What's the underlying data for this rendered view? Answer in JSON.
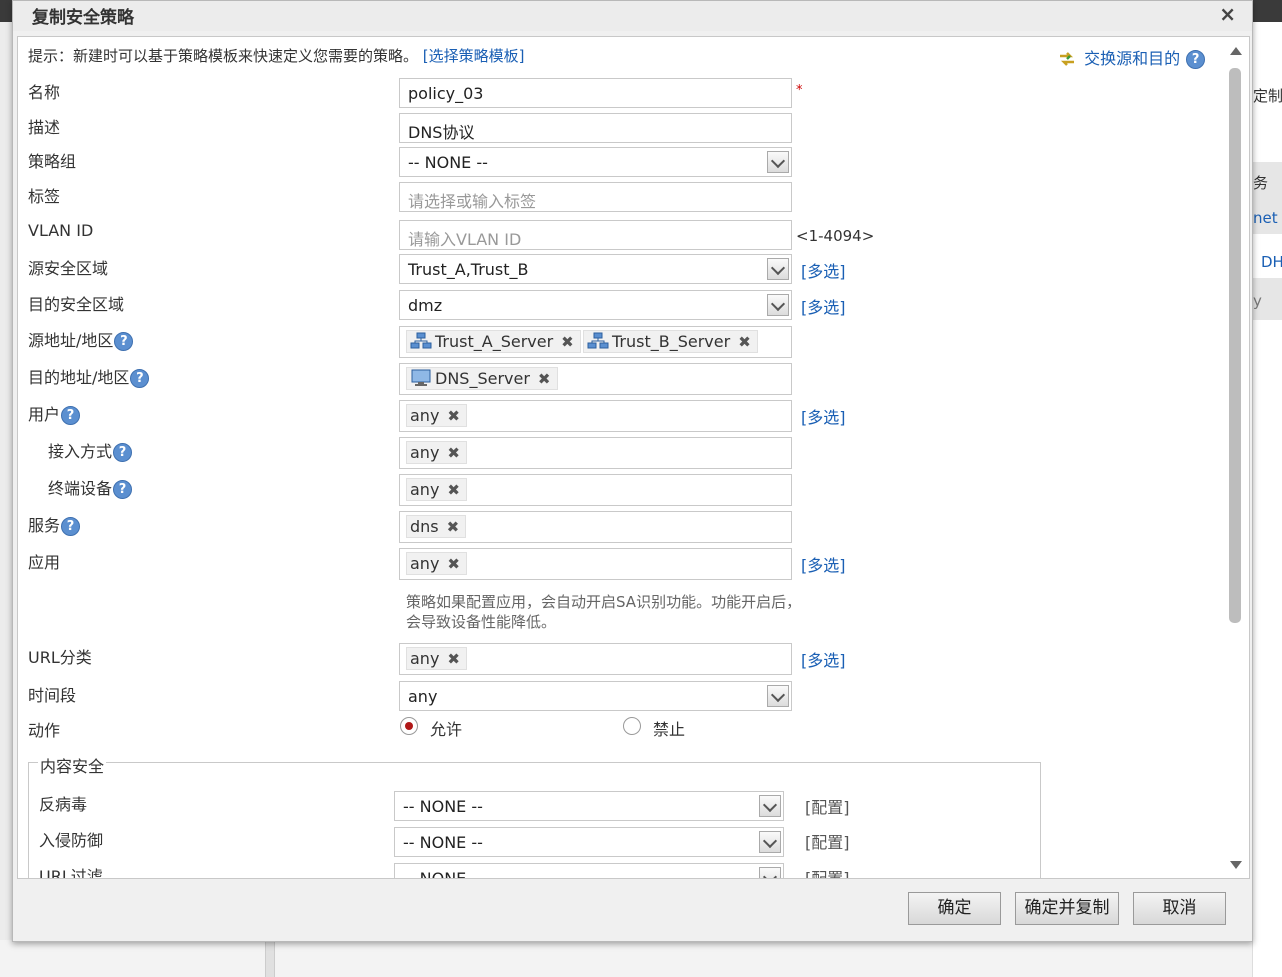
{
  "background": {
    "right_fragments": [
      "定制",
      "务",
      "net",
      "DH",
      "y"
    ]
  },
  "dialog": {
    "title": "复制安全策略",
    "close_glyph": "×"
  },
  "hint": {
    "text": "提示：新建时可以基于策略模板来快速定义您需要的策略。",
    "link": "[选择策略模板]",
    "swap_link": "交换源和目的"
  },
  "form": {
    "name": {
      "label": "名称",
      "value": "policy_03",
      "required_mark": "*"
    },
    "description": {
      "label": "描述",
      "value": "DNS协议"
    },
    "policy_group": {
      "label": "策略组",
      "value": "-- NONE --"
    },
    "tags": {
      "label": "标签",
      "placeholder": "请选择或输入标签"
    },
    "vlan": {
      "label": "VLAN ID",
      "placeholder": "请输入VLAN ID",
      "range": "<1-4094>"
    },
    "src_zone": {
      "label": "源安全区域",
      "value": "Trust_A,Trust_B",
      "multi": "[多选]"
    },
    "dst_zone": {
      "label": "目的安全区域",
      "value": "dmz",
      "multi": "[多选]"
    },
    "src_addr": {
      "label": "源地址/地区",
      "tags": [
        "Trust_A_Server",
        "Trust_B_Server"
      ]
    },
    "dst_addr": {
      "label": "目的地址/地区",
      "tags": [
        "DNS_Server"
      ]
    },
    "user": {
      "label": "用户",
      "tags": [
        "any"
      ],
      "multi": "[多选]"
    },
    "access_mode": {
      "label": "接入方式",
      "tags": [
        "any"
      ]
    },
    "terminal": {
      "label": "终端设备",
      "tags": [
        "any"
      ]
    },
    "service": {
      "label": "服务",
      "tags": [
        "dns"
      ]
    },
    "application": {
      "label": "应用",
      "tags": [
        "any"
      ],
      "multi": "[多选]",
      "note": "策略如果配置应用，会自动开启SA识别功能。功能开启后，会导致设备性能降低。"
    },
    "url_category": {
      "label": "URL分类",
      "tags": [
        "any"
      ],
      "multi": "[多选]"
    },
    "time_range": {
      "label": "时间段",
      "value": "any"
    },
    "action": {
      "label": "动作",
      "allow": "允许",
      "deny": "禁止",
      "selected": "allow"
    }
  },
  "content_security": {
    "legend": "内容安全",
    "rows": [
      {
        "label": "反病毒",
        "value": "-- NONE --",
        "config": "[配置]"
      },
      {
        "label": "入侵防御",
        "value": "-- NONE --",
        "config": "[配置]"
      },
      {
        "label": "URL过滤",
        "value": "-- NONE --",
        "config": "[配置]"
      }
    ]
  },
  "help_glyph": "?",
  "remove_glyph": "✖",
  "footer": {
    "ok": "确定",
    "ok_copy": "确定并复制",
    "cancel": "取消"
  },
  "colors": {
    "link": "#1a5fb4",
    "radio_selected": "#b01818",
    "required": "#cc0000"
  }
}
